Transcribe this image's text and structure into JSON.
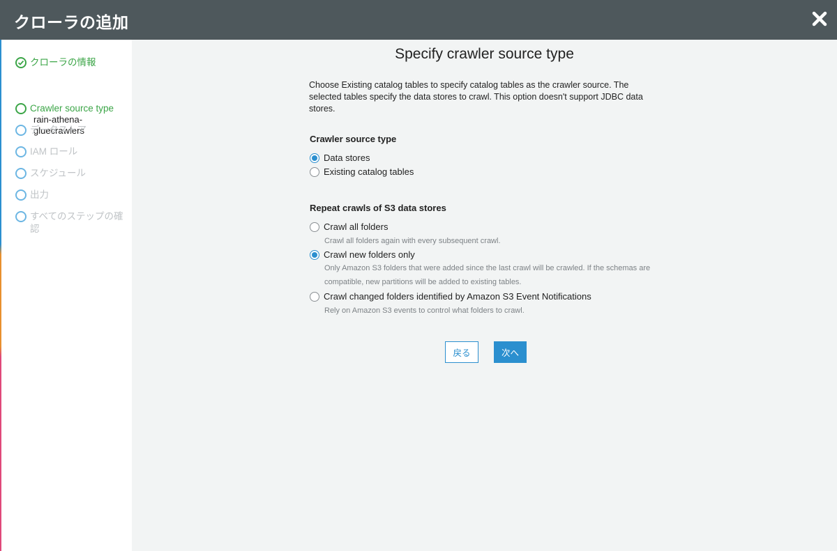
{
  "header": {
    "title": "クローラの追加",
    "close_icon": "close-icon"
  },
  "sidebar": {
    "steps": [
      {
        "label": "クローラの情報",
        "state": "done",
        "sub": "rain-athena-gluecrawlers"
      },
      {
        "label": "Crawler source type",
        "state": "current"
      },
      {
        "label": "データストア",
        "state": "todo"
      },
      {
        "label": "IAM ロール",
        "state": "todo"
      },
      {
        "label": "スケジュール",
        "state": "todo"
      },
      {
        "label": "出力",
        "state": "todo"
      },
      {
        "label": "すべてのステップの確認",
        "state": "todo"
      }
    ]
  },
  "main": {
    "title": "Specify crawler source type",
    "description": "Choose Existing catalog tables to specify catalog tables as the crawler source. The selected tables specify the data stores to crawl. This option doesn't support JDBC data stores.",
    "source_type": {
      "heading": "Crawler source type",
      "options": [
        {
          "label": "Data stores",
          "checked": true
        },
        {
          "label": "Existing catalog tables",
          "checked": false
        }
      ]
    },
    "repeat_crawls": {
      "heading": "Repeat crawls of S3 data stores",
      "options": [
        {
          "label": "Crawl all folders",
          "hint": "Crawl all folders again with every subsequent crawl.",
          "checked": false
        },
        {
          "label": "Crawl new folders only",
          "hint": "Only Amazon S3 folders that were added since the last crawl will be crawled. If the schemas are compatible, new partitions will be added to existing tables.",
          "checked": true
        },
        {
          "label": "Crawl changed folders identified by Amazon S3 Event Notifications",
          "hint": "Rely on Amazon S3 events to control what folders to crawl.",
          "checked": false
        }
      ]
    },
    "buttons": {
      "back": "戻る",
      "next": "次へ"
    }
  },
  "colors": {
    "header_bg": "#4e585c",
    "accent": "#2b8fcf",
    "success": "#3ba547",
    "inactive": "#bfc3c6"
  }
}
